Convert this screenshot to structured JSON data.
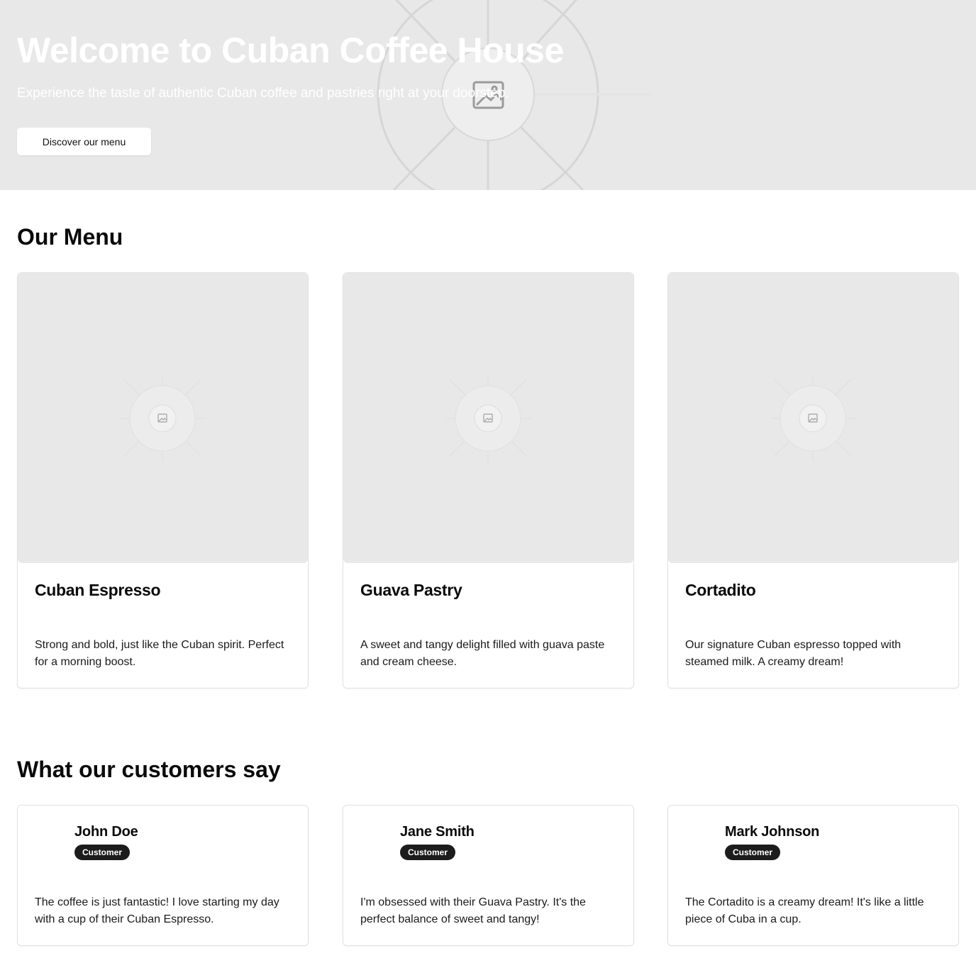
{
  "hero": {
    "title": "Welcome to Cuban Coffee House",
    "subtitle": "Experience the taste of authentic Cuban coffee and pastries right at your doorstep.",
    "button_label": "Discover our menu",
    "image_icon": "image-placeholder-icon"
  },
  "menu": {
    "title": "Our Menu",
    "items": [
      {
        "name": "Cuban Espresso",
        "description": "Strong and bold, just like the Cuban spirit. Perfect for a morning boost.",
        "image_icon": "image-placeholder-icon"
      },
      {
        "name": "Guava Pastry",
        "description": "A sweet and tangy delight filled with guava paste and cream cheese.",
        "image_icon": "image-placeholder-icon"
      },
      {
        "name": "Cortadito",
        "description": "Our signature Cuban espresso topped with steamed milk. A creamy dream!",
        "image_icon": "image-placeholder-icon"
      }
    ]
  },
  "testimonials": {
    "title": "What our customers say",
    "items": [
      {
        "name": "John Doe",
        "badge": "Customer",
        "quote": "The coffee is just fantastic! I love starting my day with a cup of their Cuban Espresso."
      },
      {
        "name": "Jane Smith",
        "badge": "Customer",
        "quote": "I'm obsessed with their Guava Pastry. It's the perfect balance of sweet and tangy!"
      },
      {
        "name": "Mark Johnson",
        "badge": "Customer",
        "quote": "The Cortadito is a creamy dream! It's like a little piece of Cuba in a cup."
      }
    ]
  },
  "colors": {
    "placeholder_bg": "#e8e8e8",
    "badge_bg": "#1c1c1c",
    "text": "#111111"
  }
}
